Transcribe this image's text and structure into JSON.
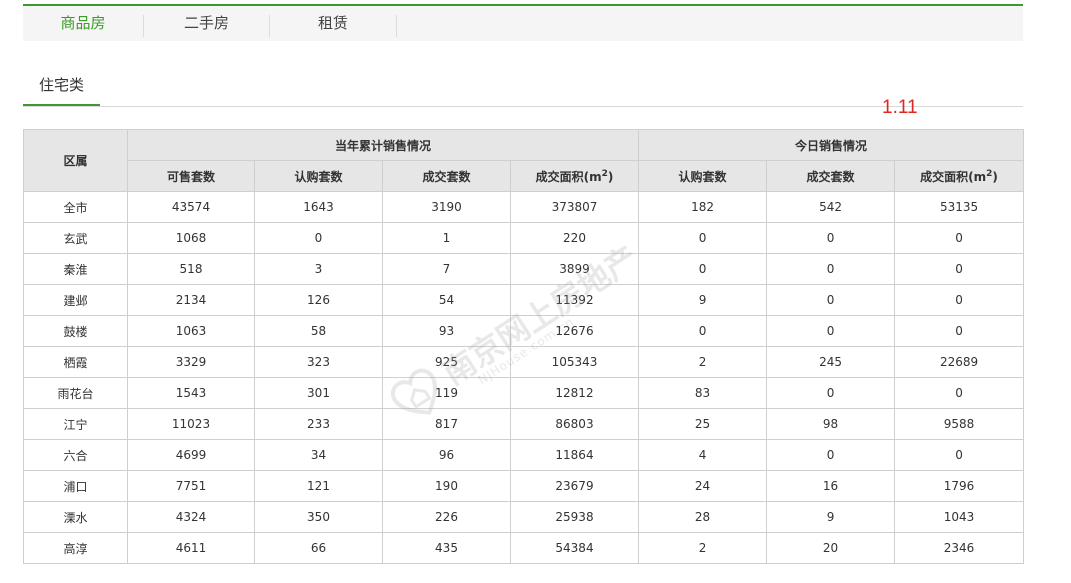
{
  "tabs": [
    {
      "label": "商品房",
      "active": true
    },
    {
      "label": "二手房",
      "active": false
    },
    {
      "label": "租赁",
      "active": false
    }
  ],
  "subtab": {
    "label": "住宅类"
  },
  "date": "1.11",
  "table": {
    "region_header": "区属",
    "group_year": "当年累计销售情况",
    "group_today": "今日销售情况",
    "year_cols": [
      "可售套数",
      "认购套数",
      "成交套数",
      "成交面积(m"
    ],
    "today_cols": [
      "认购套数",
      "成交套数",
      "成交面积(m"
    ],
    "area_sup": "2",
    "area_close": ")",
    "rows": [
      {
        "region": "全市",
        "cells": [
          "43574",
          "1643",
          "3190",
          "373807",
          "182",
          "542",
          "53135"
        ]
      },
      {
        "region": "玄武",
        "cells": [
          "1068",
          "0",
          "1",
          "220",
          "0",
          "0",
          "0"
        ]
      },
      {
        "region": "秦淮",
        "cells": [
          "518",
          "3",
          "7",
          "3899",
          "0",
          "0",
          "0"
        ]
      },
      {
        "region": "建邺",
        "cells": [
          "2134",
          "126",
          "54",
          "11392",
          "9",
          "0",
          "0"
        ]
      },
      {
        "region": "鼓楼",
        "cells": [
          "1063",
          "58",
          "93",
          "12676",
          "0",
          "0",
          "0"
        ]
      },
      {
        "region": "栖霞",
        "cells": [
          "3329",
          "323",
          "925",
          "105343",
          "2",
          "245",
          "22689"
        ]
      },
      {
        "region": "雨花台",
        "cells": [
          "1543",
          "301",
          "119",
          "12812",
          "83",
          "0",
          "0"
        ]
      },
      {
        "region": "江宁",
        "cells": [
          "11023",
          "233",
          "817",
          "86803",
          "25",
          "98",
          "9588"
        ]
      },
      {
        "region": "六合",
        "cells": [
          "4699",
          "34",
          "96",
          "11864",
          "4",
          "0",
          "0"
        ]
      },
      {
        "region": "浦口",
        "cells": [
          "7751",
          "121",
          "190",
          "23679",
          "24",
          "16",
          "1796"
        ]
      },
      {
        "region": "溧水",
        "cells": [
          "4324",
          "350",
          "226",
          "25938",
          "28",
          "9",
          "1043"
        ]
      },
      {
        "region": "高淳",
        "cells": [
          "4611",
          "66",
          "435",
          "54384",
          "2",
          "20",
          "2346"
        ]
      }
    ]
  },
  "watermark": {
    "main": "南京网上房地产",
    "sub": "NJHouse.com.cn"
  },
  "colors": {
    "accent": "#3a9a2a",
    "date": "#e0261c",
    "header_bg": "#e6e6e6"
  }
}
